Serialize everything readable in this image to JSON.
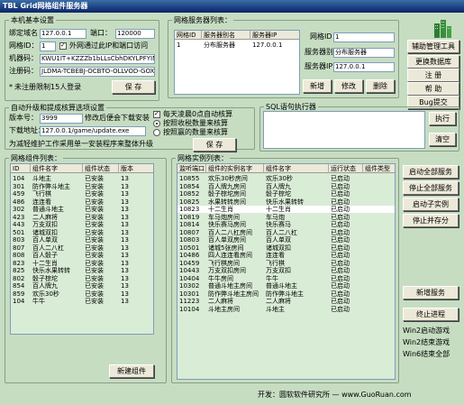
{
  "window": {
    "title": "TBL Grid网格组件服务器"
  },
  "basic": {
    "legend": "本机基本设置",
    "bind_label": "绑定域名",
    "bind_value": "127.0.0.1",
    "port_label": "端口：",
    "port_value": "120000",
    "gridid_label": "网格ID：",
    "gridid_value": "1",
    "allow_text": "外网通过此IP和端口访问",
    "machine_label": "机器码：",
    "machine_value": "KWU1IT+KZZZb1bLLsCbhDKYLPFYIMPTXE",
    "reg_label": "注册码：",
    "reg_value": "JLDMA-TCBEBJ-OCBTO-OLLVOD-GOXBD",
    "unreg_text": "未注册限制15人登录",
    "save": "保 存"
  },
  "update": {
    "legend": "自动升级和提成核算选项设置",
    "ver_label": "版本号：",
    "ver_value": "3999",
    "ver_note": "修改后便会下载安装",
    "dl_label": "下载地址：",
    "dl_value": "127.0.0.1/game/update.exe",
    "daily_text": "每天凌晨0点自动核算",
    "opt1": "按照收税数量来核算",
    "opt2": "按照赢的数量来核算",
    "footer": "为减轻维护工作采用单一安装程序来整体升级",
    "save": "保 存"
  },
  "gridserver": {
    "legend": "网格服务器列表：",
    "columns": [
      "网格ID",
      "服务器别名",
      "服务器IP"
    ],
    "rows": [
      [
        "1",
        "分布服务器",
        "127.0.0.1"
      ]
    ],
    "id_label": "网格ID：",
    "id_value": "1",
    "alias_label": "服务器别名：",
    "alias_value": "分布服务器",
    "ip_label": "服务器IP：",
    "ip_value": "127.0.0.1",
    "add": "新增",
    "edit": "修改",
    "del": "删除"
  },
  "sql": {
    "legend": "SQL语句执行器",
    "exec": "执行",
    "clear": "清空"
  },
  "tools": {
    "helper": "辅助管理工具",
    "update_svc": "更换数据库",
    "register": "注 册",
    "help": "帮 助",
    "bug": "Bug提交"
  },
  "components": {
    "legend": "网格组件列表：",
    "columns": [
      "ID",
      "组件名字",
      "组件状态",
      "版本"
    ],
    "rows": [
      [
        "104",
        "斗地主",
        "已安装",
        "13"
      ],
      [
        "301",
        "防作弊斗地主",
        "已安装",
        "13"
      ],
      [
        "459",
        "飞行棋",
        "已安装",
        "13"
      ],
      [
        "486",
        "连连看",
        "已安装",
        "13"
      ],
      [
        "302",
        "普通斗地主",
        "已安装",
        "13"
      ],
      [
        "423",
        "二人麻将",
        "已安装",
        "13"
      ],
      [
        "443",
        "万支双扣",
        "已安装",
        "13"
      ],
      [
        "501",
        "诸城双扣",
        "已安装",
        "13"
      ],
      [
        "803",
        "百人单双",
        "已安装",
        "13"
      ],
      [
        "807",
        "百人二八杠",
        "已安装",
        "13"
      ],
      [
        "808",
        "百人骰子",
        "已安装",
        "13"
      ],
      [
        "823",
        "十二生肖",
        "已安装",
        "13"
      ],
      [
        "825",
        "快乐水果转转",
        "已安装",
        "13"
      ],
      [
        "802",
        "骰子棕坨",
        "已安装",
        "13"
      ],
      [
        "854",
        "百人牌九",
        "已安装",
        "13"
      ],
      [
        "859",
        "欢乐30秒",
        "已安装",
        "13"
      ],
      [
        "104",
        "牛牛",
        "已安装",
        "13"
      ]
    ],
    "new_btn": "新建组件"
  },
  "instances": {
    "legend": "网格实例列表：",
    "columns": [
      "监听端口",
      "组件的实例名字",
      "组件名字",
      "运行状态",
      "组件类型"
    ],
    "rows": [
      [
        "10855",
        "欢乐30秒房间",
        "欢乐30秒",
        "已启动",
        ""
      ],
      [
        "10854",
        "百人牌九房间",
        "百人牌九",
        "已启动",
        ""
      ],
      [
        "10852",
        "骰子棕坨房间",
        "骰子棕坨",
        "已启动",
        ""
      ],
      [
        "10825",
        "水果转转房间",
        "快乐水果转转",
        "已启动",
        ""
      ],
      [
        "10823",
        "十二生肖",
        "十二生肖",
        "已启动",
        ""
      ],
      [
        "10819",
        "车马炮房间",
        "车马炮",
        "已启动",
        ""
      ],
      [
        "10814",
        "快乐赛马房间",
        "快乐赛马",
        "已启动",
        ""
      ],
      [
        "10807",
        "百人二八杠房间",
        "百人二八杠",
        "已启动",
        ""
      ],
      [
        "10803",
        "百人单双房间",
        "百人单双",
        "已启动",
        ""
      ],
      [
        "10501",
        "诸城5张房间",
        "诸城双扣",
        "已启动",
        ""
      ],
      [
        "10486",
        "四人连连看房间",
        "连连看",
        "已启动",
        ""
      ],
      [
        "10459",
        "飞行棋房间",
        "飞行棋",
        "已启动",
        ""
      ],
      [
        "10443",
        "万支双扣房间",
        "万支双扣",
        "已启动",
        ""
      ],
      [
        "10404",
        "牛牛房间",
        "牛牛",
        "已启动",
        ""
      ],
      [
        "10302",
        "普通斗地主房间",
        "普通斗地主",
        "已启动",
        ""
      ],
      [
        "10301",
        "防作弊斗地主房间",
        "防作弊斗地主",
        "已启动",
        ""
      ],
      [
        "11223",
        "二人麻将",
        "二人麻将",
        "已启动",
        ""
      ],
      [
        "10104",
        "斗地主房间",
        "斗地主",
        "已启动",
        ""
      ]
    ],
    "selected_row": 4
  },
  "right_buttons": {
    "start_all": "启动全部服务",
    "stop_all": "停止全部服务",
    "start_inst": "启动子实例",
    "stop_save": "停止并存分",
    "new_service": "新增服务",
    "end_proc": "终止进程",
    "win2_start": "Win2启动游戏",
    "win2_end": "Win2结束游戏",
    "win_end_all": "Win6结束全部"
  },
  "footer": {
    "text": "开发：圆软软件研究所 — www.GuoRuan.com"
  }
}
